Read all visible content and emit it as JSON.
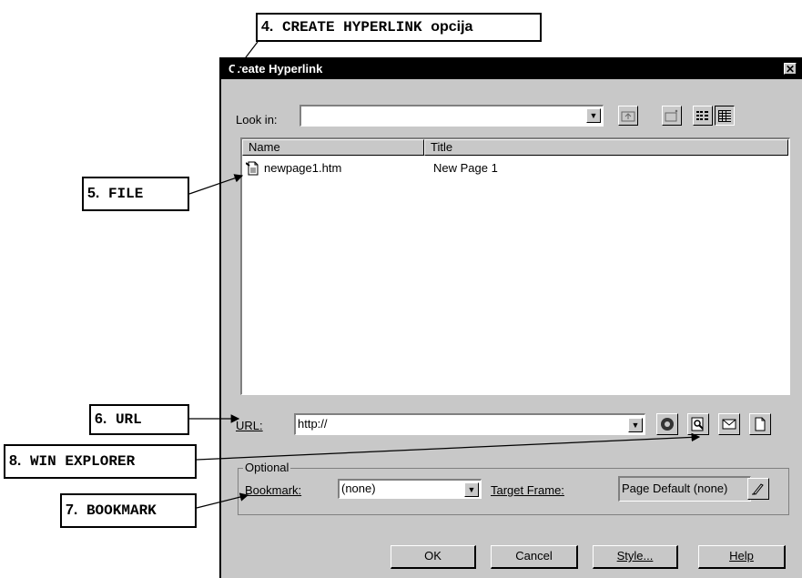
{
  "dialog": {
    "title": "Create Hyperlink",
    "close_glyph": "✕",
    "look_in_label": "Look in:",
    "look_in_value": "",
    "file_list": {
      "columns": [
        "Name",
        "Title"
      ],
      "rows": [
        {
          "name": "newpage1.htm",
          "title": "New Page 1",
          "icon": "html-file-icon"
        }
      ]
    },
    "url_label": "URL:",
    "url_value": "http://",
    "optional_label": "Optional",
    "bookmark_label": "Bookmark:",
    "bookmark_value": "(none)",
    "target_frame_label": "Target Frame:",
    "target_frame_value": "Page Default (none)",
    "buttons": {
      "ok": "OK",
      "cancel": "Cancel",
      "style": "Style...",
      "help": "Help"
    }
  },
  "callouts": {
    "create_hyperlink": {
      "num": "4.",
      "text": "CREATE HYPERLINK",
      "suffix": "opcija"
    },
    "file": {
      "num": "5.",
      "text": "FILE"
    },
    "url": {
      "num": "6.",
      "text": "URL"
    },
    "bookmark": {
      "num": "7.",
      "text": "BOOKMARK"
    },
    "win_explorer": {
      "num": "8.",
      "text": "WIN EXPLORER"
    }
  }
}
